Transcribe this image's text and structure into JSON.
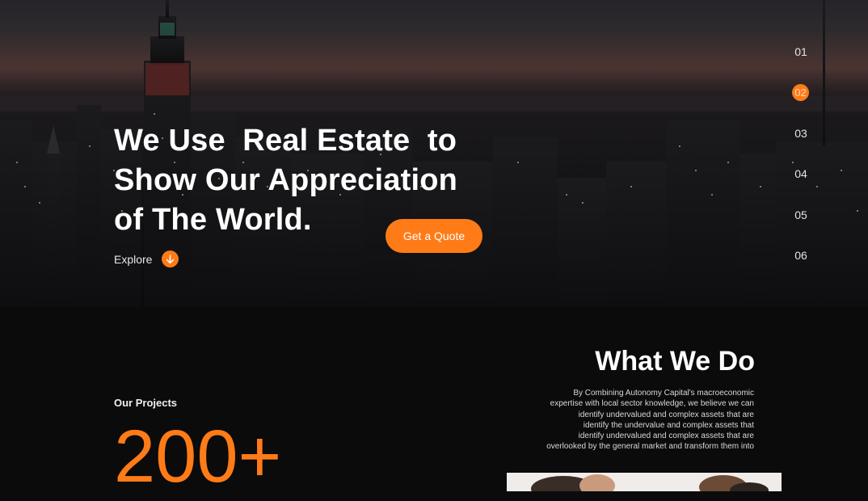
{
  "hero": {
    "title_lines": [
      "We Use  Real Estate  to",
      "Show Our Appreciation",
      "of The World."
    ],
    "cta_label": "Get a Quote",
    "explore_label": "Explore",
    "explore_icon": "arrow-down-icon"
  },
  "pager": {
    "items": [
      "01",
      "02",
      "03",
      "04",
      "05",
      "06"
    ],
    "active_index": 1
  },
  "projects": {
    "label": "Our Projects",
    "count": "200+"
  },
  "what_we_do": {
    "title": "What We Do",
    "text_lines": [
      "By Combining Autonomy Capital's macroeconomic",
      "expertise with local sector knowledge, we believe we can",
      "identify undervalued and complex assets that are",
      "identify the undervalue and complex assets that",
      "identify undervalued and complex assets that are",
      "overlooked by the general market and transform them into"
    ]
  },
  "colors": {
    "accent": "#ff7b17",
    "background": "#0b0b0b",
    "text": "#ffffff"
  }
}
